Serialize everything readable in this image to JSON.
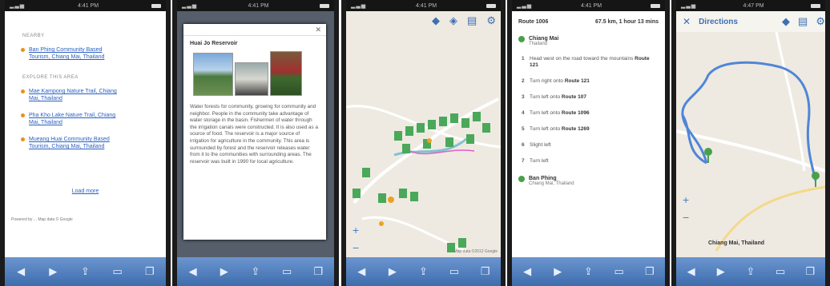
{
  "phones": [
    {
      "status": {
        "carrier": "…",
        "time": "4:41 PM"
      }
    },
    {
      "status": {
        "carrier": "…",
        "time": "4:41 PM"
      }
    },
    {
      "status": {
        "carrier": "…",
        "time": "4:41 PM"
      }
    },
    {
      "status": {
        "carrier": "…",
        "time": "4:41 PM"
      }
    },
    {
      "status": {
        "carrier": "…",
        "time": "4:47 PM"
      }
    }
  ],
  "screen1": {
    "section1": "NEARBY",
    "items1": [
      "Ban Phing Community Based Tourism, Chiang Mai, Thailand"
    ],
    "section2": "EXPLORE THIS AREA",
    "items2": [
      "Mae Kampong Nature Trail, Chiang Mai, Thailand",
      "Pha Kho Lake Nature Trail, Chiang Mai, Thailand",
      "Mueang Huai Community Based Tourism, Chiang Mai, Thailand"
    ],
    "load_link": "Load more",
    "footer": "Powered by ... Map data © Google"
  },
  "screen2": {
    "title": "Huai Jo Reservoir",
    "body": "Water forests for community, growing for community and neighbor. People in the community take advantage of water storage in the basin. Fishermen of water through the irrigation canals were constructed. It is also used as a source of food. The reservoir is a major source of irrigation for agriculture in the community. This area is surrounded by forest and the reservoir releases water from it to the communities with surrounding areas. The reservoir was built in 1990 for local agriculture."
  },
  "screen4": {
    "route": "Route 1006",
    "summary": "67.5 km, 1 hour 13 mins",
    "start": {
      "name": "Chiang Mai",
      "sub": "Thailand"
    },
    "steps": [
      {
        "n": "1",
        "text": "Head west on the road toward the mountains ",
        "road": "Route 121"
      },
      {
        "n": "2",
        "text": "Turn right onto ",
        "road": "Route 121"
      },
      {
        "n": "3",
        "text": "Turn left onto ",
        "road": "Route 107"
      },
      {
        "n": "4",
        "text": "Turn left onto ",
        "road": "Route 1096"
      },
      {
        "n": "5",
        "text": "Turn left onto ",
        "road": "Route 1269"
      },
      {
        "n": "6",
        "text": "Slight left",
        "road": ""
      },
      {
        "n": "7",
        "text": "Turn left",
        "road": ""
      }
    ],
    "end": {
      "name": "Ban Phing",
      "sub": "Chiang Mai, Thailand"
    }
  },
  "screen5": {
    "title": "Directions",
    "label": "Chiang Mai, Thailand"
  },
  "map_note": "Map data ©2012 Google"
}
